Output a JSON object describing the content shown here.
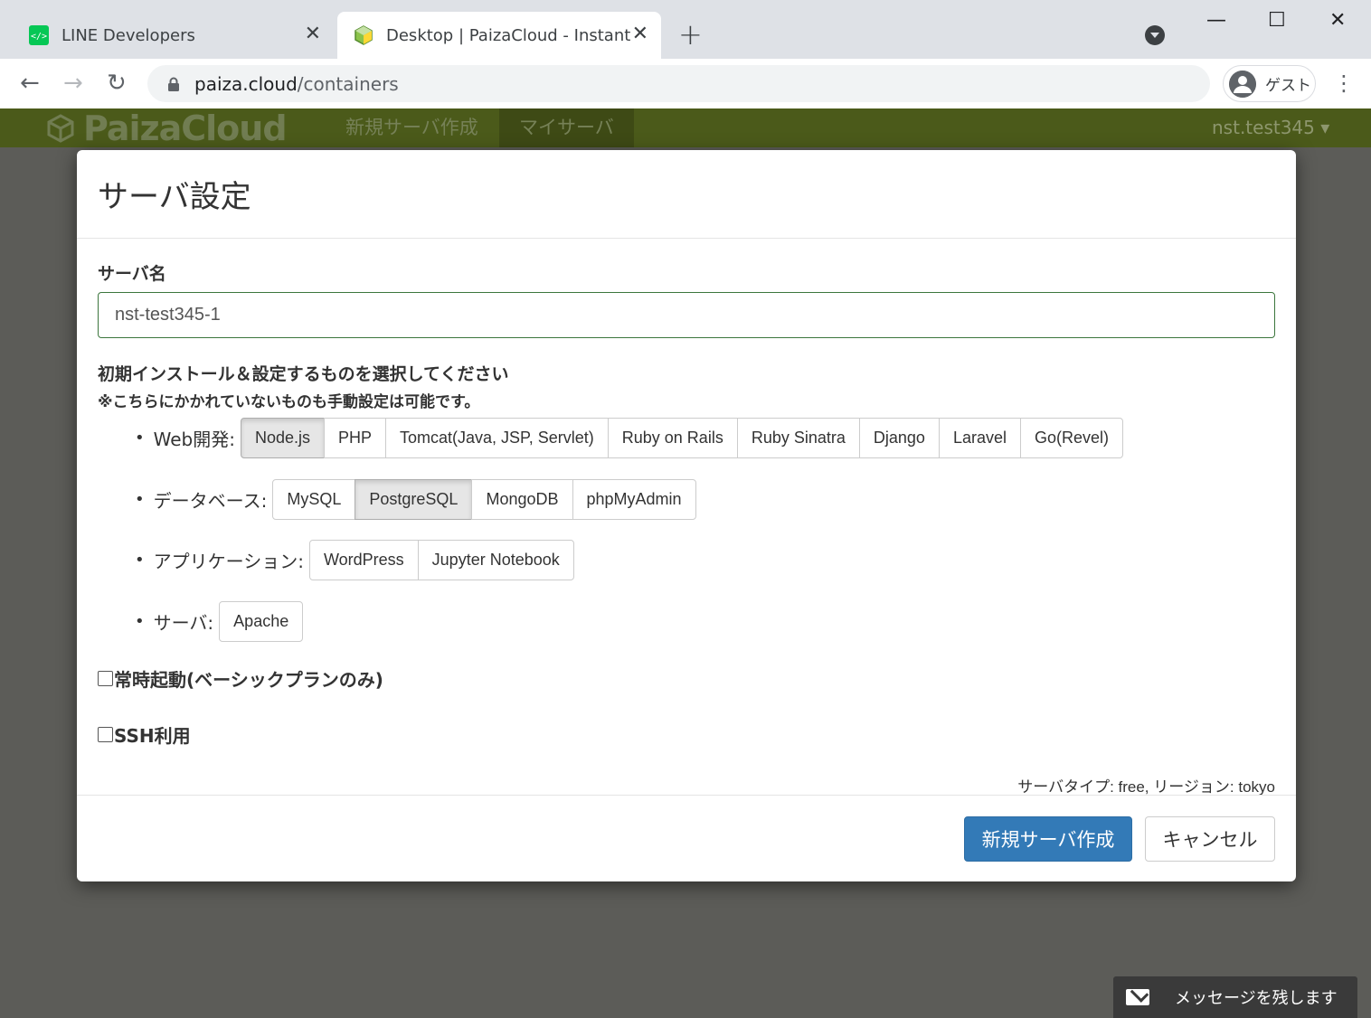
{
  "browser": {
    "tabs": [
      {
        "title": "LINE Developers",
        "close": "✕"
      },
      {
        "title": "Desktop | PaizaCloud - Instant Linux",
        "close": "✕"
      }
    ],
    "new_tab": "+",
    "window": {
      "minimize": "—",
      "maximize": "☐",
      "close": "✕"
    },
    "nav": {
      "back": "←",
      "forward": "→",
      "reload": "↻"
    },
    "url_host": "paiza.cloud",
    "url_path": "/containers",
    "profile_label": "ゲスト",
    "menu": "⋮"
  },
  "site": {
    "logo_text": "PaizaCloud",
    "nav_items": [
      "新規サーバ作成",
      "マイサーバ"
    ],
    "active_nav": "マイサーバ",
    "user_menu": "nst.test345 ▾"
  },
  "modal": {
    "title": "サーバ設定",
    "server_name_label": "サーバ名",
    "server_name_value": "nst-test345-1",
    "install_heading": "初期インストール＆設定するものを選択してください",
    "install_note": "※こちらにかかれていないものも手動設定は可能です。",
    "categories": [
      {
        "label": "Web開発:",
        "options": [
          "Node.js",
          "PHP",
          "Tomcat(Java, JSP, Servlet)",
          "Ruby on Rails",
          "Ruby Sinatra",
          "Django",
          "Laravel",
          "Go(Revel)"
        ],
        "selected": [
          "Node.js"
        ]
      },
      {
        "label": "データベース:",
        "options": [
          "MySQL",
          "PostgreSQL",
          "MongoDB",
          "phpMyAdmin"
        ],
        "selected": [
          "PostgreSQL"
        ]
      },
      {
        "label": "アプリケーション:",
        "options": [
          "WordPress",
          "Jupyter Notebook"
        ],
        "selected": []
      },
      {
        "label": "サーバ:",
        "options": [
          "Apache"
        ],
        "selected": []
      }
    ],
    "always_on_label": "常時起動(ベーシックプランのみ)",
    "always_on_checked": false,
    "ssh_label": "SSH利用",
    "ssh_checked": false,
    "server_info": "サーバタイプ: free, リージョン: tokyo",
    "create_button": "新規サーバ作成",
    "cancel_button": "キャンセル"
  },
  "message_widget": {
    "label": "メッセージを残します"
  },
  "colors": {
    "navbar": "#4b5a1a",
    "primary": "#337ab7",
    "input_border": "#3c763d"
  }
}
